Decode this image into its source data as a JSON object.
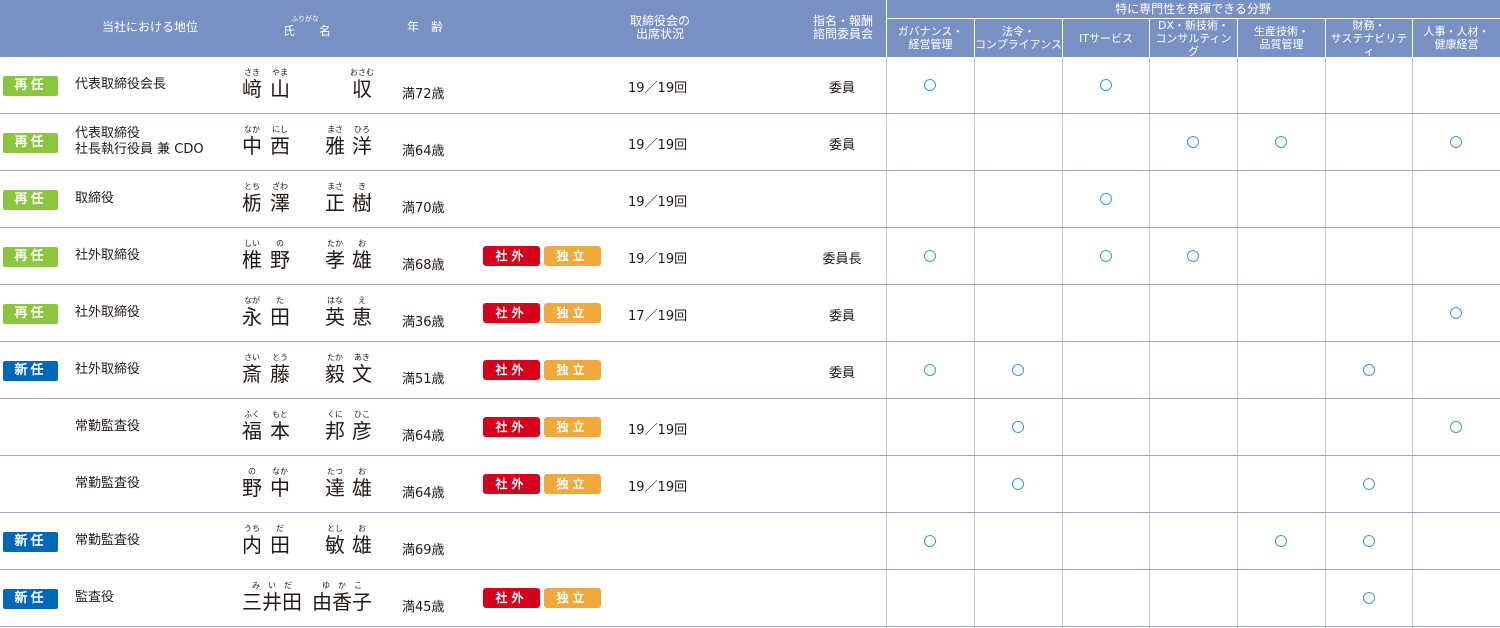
{
  "header": {
    "position": "当社における地位",
    "name_ruby": "ふりがな",
    "name": "氏　　名",
    "age": "年　齢",
    "attendance": "取締役会の\n出席状況",
    "committee": "指名・報酬\n諮問委員会",
    "expertise_group": "特に専門性を発揮できる分野",
    "expertise": [
      "ガバナンス・\n経営管理",
      "法令・\nコンプライアンス",
      "ITサービス",
      "DX・新技術・\nコンサルティング",
      "生産技術・\n品質管理",
      "財務・\nサステナビリティ",
      "人事・人材・\n健康経営"
    ]
  },
  "tags": {
    "outside": "社外",
    "independent": "独立"
  },
  "mark_symbol": "○",
  "colors": {
    "header_bg": "#7990c3",
    "reappoint_badge": "#8cc63f",
    "new_badge": "#0068b7",
    "outside_tag": "#d6001c",
    "independent_tag": "#f2a93b",
    "mark": "#3d9bd5"
  },
  "rows": [
    {
      "badge": "再任",
      "badge_type": "reappoint",
      "position": [
        "代表取締役会長"
      ],
      "name": [
        {
          "k": "﨑",
          "r": "さき"
        },
        {
          "k": "山",
          "r": "やま"
        },
        {
          "k": "収",
          "r": "おさむ"
        }
      ],
      "age": "満72歳",
      "outside": false,
      "independent": false,
      "attendance": "19／19回",
      "committee": "委員",
      "expertise": [
        true,
        false,
        true,
        false,
        false,
        false,
        false
      ]
    },
    {
      "badge": "再任",
      "badge_type": "reappoint",
      "position": [
        "代表取締役",
        "社長執行役員 兼 CDO"
      ],
      "name": [
        {
          "k": "中",
          "r": "なか"
        },
        {
          "k": "西",
          "r": "にし"
        },
        {
          "k": "雅",
          "r": "まさ"
        },
        {
          "k": "洋",
          "r": "ひろ"
        }
      ],
      "age": "満64歳",
      "outside": false,
      "independent": false,
      "attendance": "19／19回",
      "committee": "委員",
      "expertise": [
        false,
        false,
        false,
        true,
        true,
        false,
        true
      ]
    },
    {
      "badge": "再任",
      "badge_type": "reappoint",
      "position": [
        "取締役"
      ],
      "name": [
        {
          "k": "栃",
          "r": "とち"
        },
        {
          "k": "澤",
          "r": "ざわ"
        },
        {
          "k": "正",
          "r": "まさ"
        },
        {
          "k": "樹",
          "r": "き"
        }
      ],
      "age": "満70歳",
      "outside": false,
      "independent": false,
      "attendance": "19／19回",
      "committee": "",
      "expertise": [
        false,
        false,
        true,
        false,
        false,
        false,
        false
      ]
    },
    {
      "badge": "再任",
      "badge_type": "reappoint",
      "position": [
        "社外取締役"
      ],
      "name": [
        {
          "k": "椎",
          "r": "しい"
        },
        {
          "k": "野",
          "r": "の"
        },
        {
          "k": "孝",
          "r": "たか"
        },
        {
          "k": "雄",
          "r": "お"
        }
      ],
      "age": "満68歳",
      "outside": true,
      "independent": true,
      "attendance": "19／19回",
      "committee": "委員長",
      "expertise": [
        true,
        false,
        true,
        true,
        false,
        false,
        false
      ]
    },
    {
      "badge": "再任",
      "badge_type": "reappoint",
      "position": [
        "社外取締役"
      ],
      "name": [
        {
          "k": "永",
          "r": "なが"
        },
        {
          "k": "田",
          "r": "た"
        },
        {
          "k": "英",
          "r": "はな"
        },
        {
          "k": "恵",
          "r": "え"
        }
      ],
      "age": "満36歳",
      "outside": true,
      "independent": true,
      "attendance": "17／19回",
      "committee": "委員",
      "expertise": [
        false,
        false,
        false,
        false,
        false,
        false,
        true
      ]
    },
    {
      "badge": "新任",
      "badge_type": "new",
      "position": [
        "社外取締役"
      ],
      "name": [
        {
          "k": "斎",
          "r": "さい"
        },
        {
          "k": "藤",
          "r": "とう"
        },
        {
          "k": "毅",
          "r": "たか"
        },
        {
          "k": "文",
          "r": "あき"
        }
      ],
      "age": "満51歳",
      "outside": true,
      "independent": true,
      "attendance": "",
      "committee": "委員",
      "expertise": [
        true,
        true,
        false,
        false,
        false,
        true,
        false
      ]
    },
    {
      "badge": "",
      "badge_type": "",
      "position": [
        "常勤監査役"
      ],
      "name": [
        {
          "k": "福",
          "r": "ふく"
        },
        {
          "k": "本",
          "r": "もと"
        },
        {
          "k": "邦",
          "r": "くに"
        },
        {
          "k": "彦",
          "r": "ひこ"
        }
      ],
      "age": "満64歳",
      "outside": true,
      "independent": true,
      "attendance": "19／19回",
      "committee": "",
      "expertise": [
        false,
        true,
        false,
        false,
        false,
        false,
        true
      ]
    },
    {
      "badge": "",
      "badge_type": "",
      "position": [
        "常勤監査役"
      ],
      "name": [
        {
          "k": "野",
          "r": "の"
        },
        {
          "k": "中",
          "r": "なか"
        },
        {
          "k": "達",
          "r": "たつ"
        },
        {
          "k": "雄",
          "r": "お"
        }
      ],
      "age": "満64歳",
      "outside": true,
      "independent": true,
      "attendance": "19／19回",
      "committee": "",
      "expertise": [
        false,
        true,
        false,
        false,
        false,
        true,
        false
      ]
    },
    {
      "badge": "新任",
      "badge_type": "new",
      "position": [
        "常勤監査役"
      ],
      "name": [
        {
          "k": "内",
          "r": "うち"
        },
        {
          "k": "田",
          "r": "だ"
        },
        {
          "k": "敏",
          "r": "とし"
        },
        {
          "k": "雄",
          "r": "お"
        }
      ],
      "age": "満69歳",
      "outside": false,
      "independent": false,
      "attendance": "",
      "committee": "",
      "expertise": [
        true,
        false,
        false,
        false,
        true,
        true,
        false
      ]
    },
    {
      "badge": "新任",
      "badge_type": "new",
      "position": [
        "監査役"
      ],
      "name": [
        {
          "k": "三井田",
          "r": "み　い　だ"
        },
        {
          "k": "由香子",
          "r": "ゆ　か　こ"
        }
      ],
      "age": "満45歳",
      "outside": true,
      "independent": true,
      "attendance": "",
      "committee": "",
      "expertise": [
        false,
        false,
        false,
        false,
        false,
        true,
        false
      ]
    }
  ]
}
